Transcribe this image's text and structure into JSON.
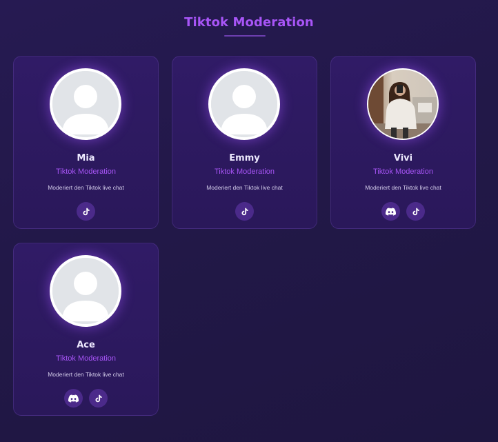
{
  "header": {
    "title": "Tiktok Moderation"
  },
  "colors": {
    "accent": "#a855f7",
    "background": "#241a4c",
    "card": "#2d1a60",
    "social_button": "#4b2a8a"
  },
  "members": [
    {
      "name": "Mia",
      "role": "Tiktok Moderation",
      "description": "Moderiert den Tiktok live chat",
      "avatar": "default-avatar",
      "socials": [
        "tiktok-icon"
      ]
    },
    {
      "name": "Emmy",
      "role": "Tiktok Moderation",
      "description": "Moderiert den Tiktok live chat",
      "avatar": "default-avatar",
      "socials": [
        "tiktok-icon"
      ]
    },
    {
      "name": "Vivi",
      "role": "Tiktok Moderation",
      "description": "Moderiert den Tiktok live chat",
      "avatar": "photo-avatar",
      "socials": [
        "discord-icon",
        "tiktok-icon"
      ]
    },
    {
      "name": "Ace",
      "role": "Tiktok Moderation",
      "description": "Moderiert den Tiktok live chat",
      "avatar": "default-avatar",
      "socials": [
        "discord-icon",
        "tiktok-icon"
      ]
    }
  ]
}
